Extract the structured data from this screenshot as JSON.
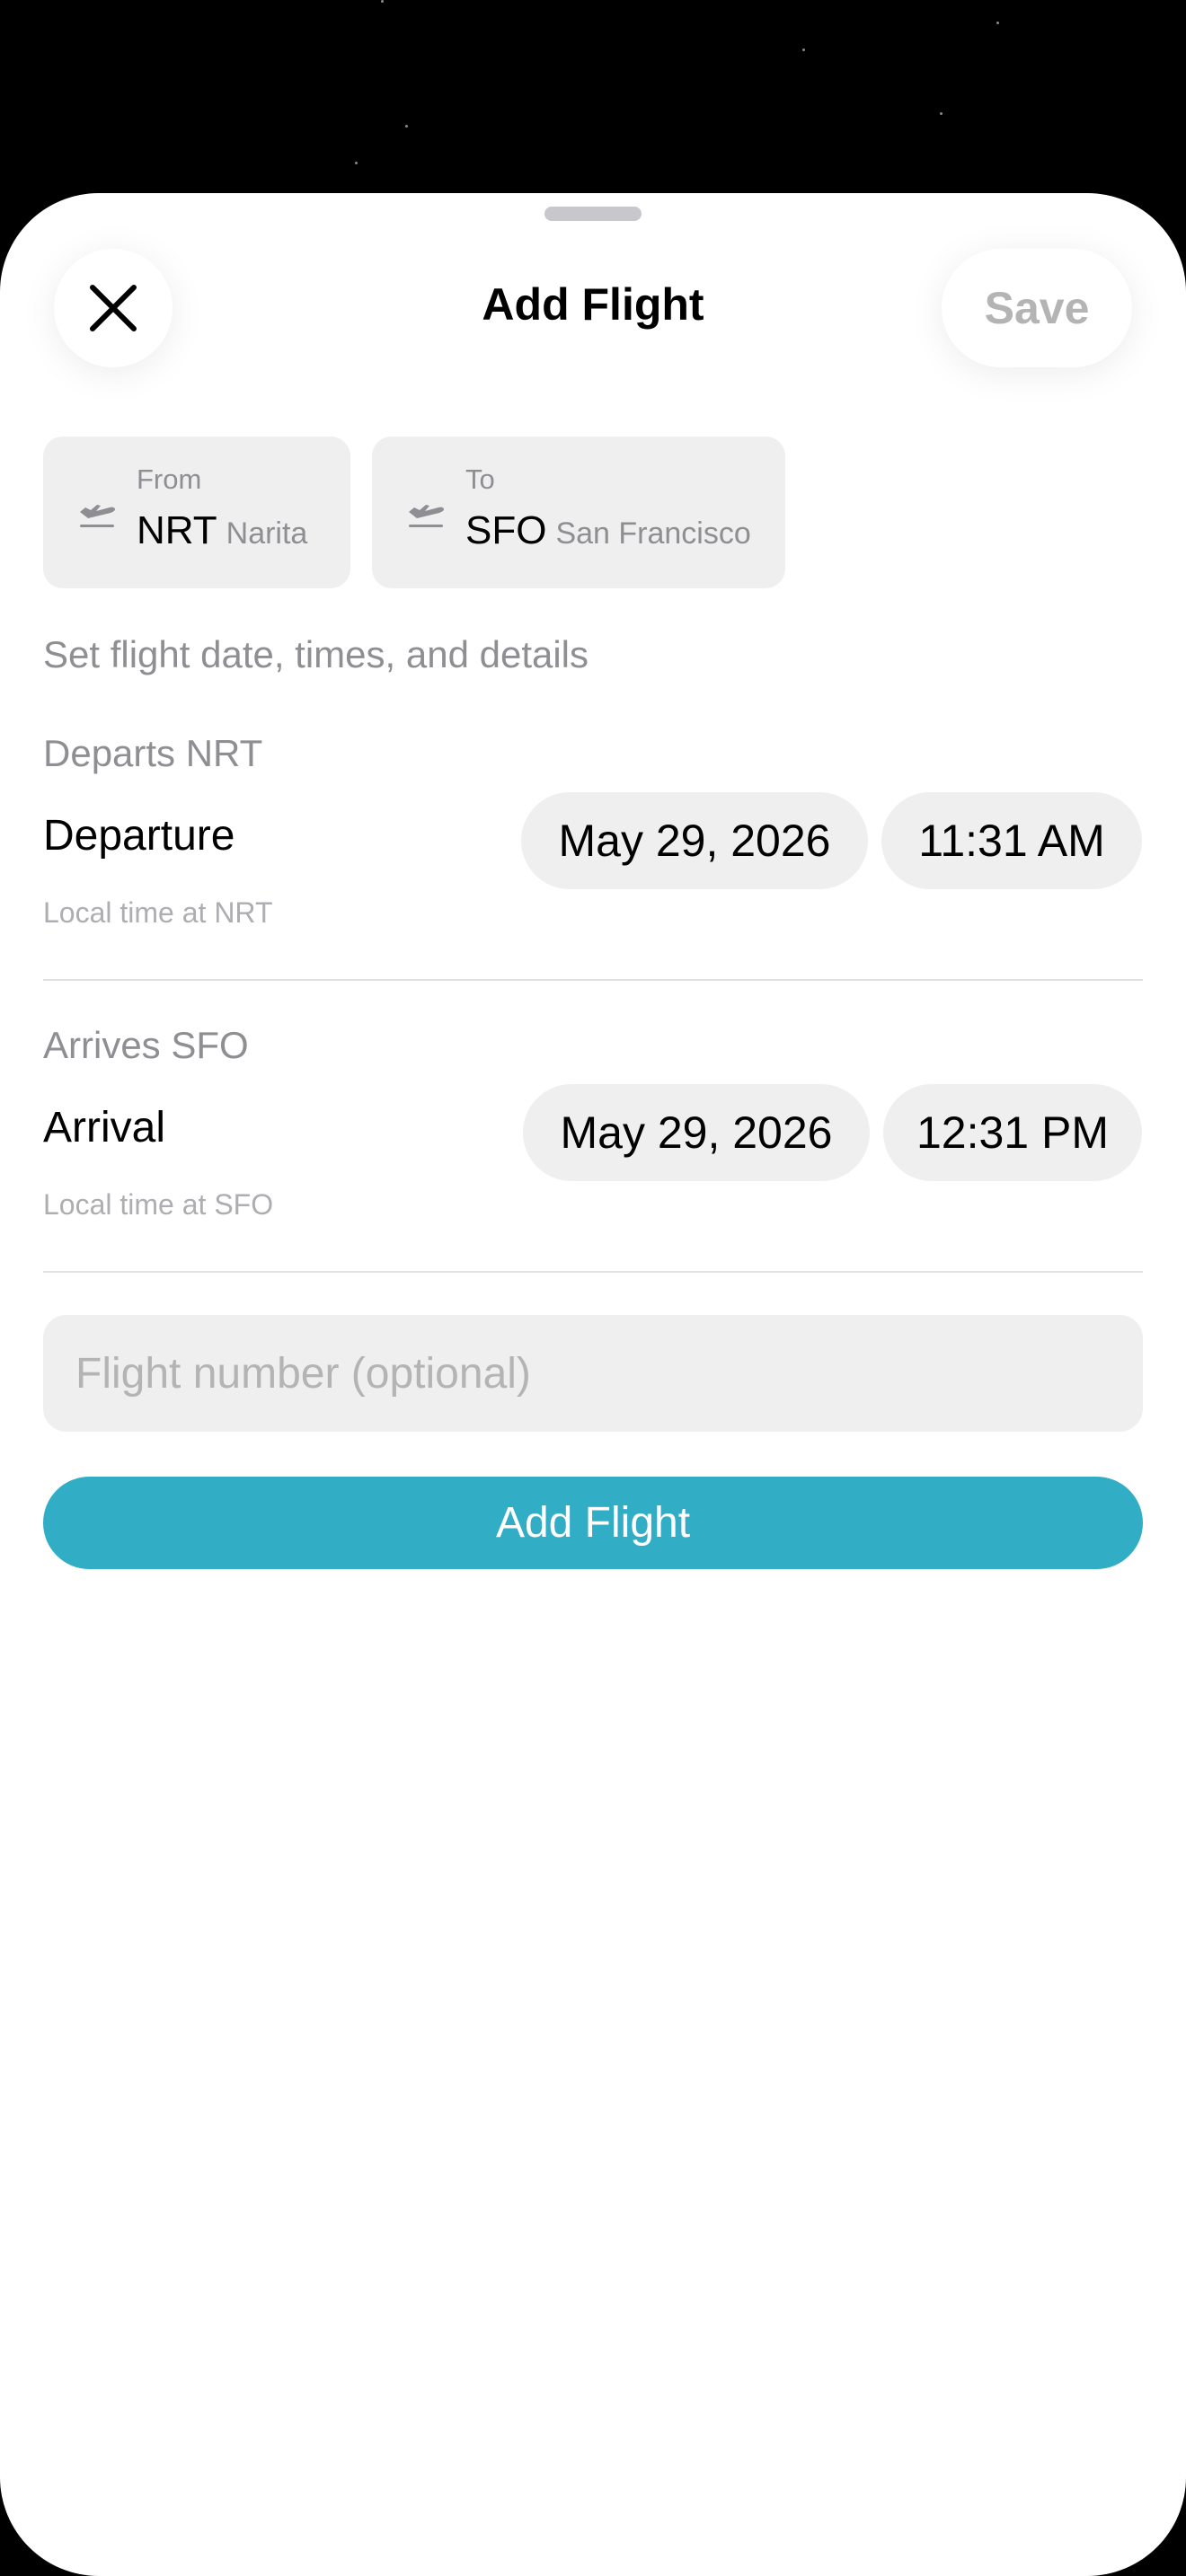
{
  "header": {
    "title": "Add Flight",
    "save_label": "Save"
  },
  "route": {
    "from": {
      "label": "From",
      "code": "NRT",
      "city": "Narita"
    },
    "to": {
      "label": "To",
      "code": "SFO",
      "city": "San Francisco"
    }
  },
  "hint": "Set flight date, times, and details",
  "departure": {
    "heading": "Departs NRT",
    "label": "Departure",
    "subtitle": "Local time at NRT",
    "date": "May 29, 2026",
    "time": "11:31 AM"
  },
  "arrival": {
    "heading": "Arrives SFO",
    "label": "Arrival",
    "subtitle": "Local time at SFO",
    "date": "May 29, 2026",
    "time": "12:31 PM"
  },
  "flight_number": {
    "value": "",
    "placeholder": "Flight number (optional)"
  },
  "submit_label": "Add Flight",
  "colors": {
    "accent": "#31adc6",
    "pill_bg": "#efefef",
    "secondary_text": "#8e8e93",
    "backdrop": "#000000"
  },
  "icons": [
    "close-icon",
    "plane-departure-icon"
  ]
}
